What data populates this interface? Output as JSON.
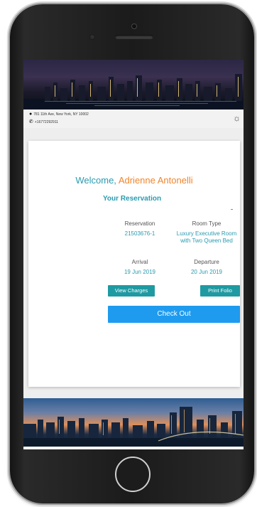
{
  "hotel": {
    "address": "781 11th Ave, New York, NY 10002",
    "phone": "+16772292911"
  },
  "welcome": {
    "prefix": "Welcome,",
    "guest_name": "Adrienne Antonelli"
  },
  "reservation": {
    "section_title": "Your Reservation",
    "reservation_label": "Reservation",
    "reservation_number": "21503676-1",
    "room_type_label": "Room Type",
    "room_type_line1": "Luxury Executive Room",
    "room_type_line2": "with Two Queen Bed",
    "arrival_label": "Arrival",
    "arrival_date": "19 Jun 2019",
    "departure_label": "Departure",
    "departure_date": "20 Jun 2019"
  },
  "actions": {
    "view_charges": "View Charges",
    "print_folio": "Print Folio",
    "check_out": "Check Out"
  },
  "colors": {
    "accent_teal": "#2a9bb0",
    "guest_orange": "#f0852b",
    "checkout_blue": "#1e9bef",
    "button_teal": "#1f9aa2"
  },
  "icons": [
    "location-pin-icon",
    "phone-icon",
    "sun-icon"
  ]
}
